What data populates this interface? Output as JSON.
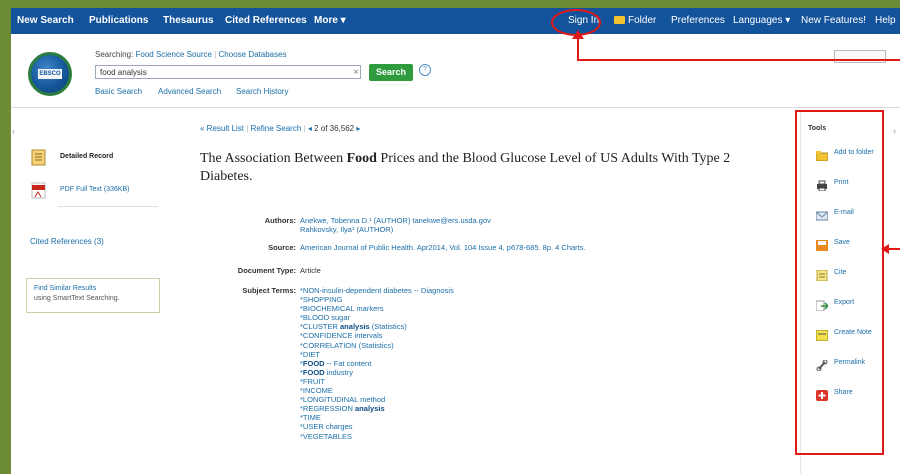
{
  "topnav": {
    "new_search": "New Search",
    "publications": "Publications",
    "thesaurus": "Thesaurus",
    "cited_references": "Cited References",
    "more": "More ▾",
    "sign_in": "Sign In",
    "folder": "Folder",
    "preferences": "Preferences",
    "languages": "Languages ▾",
    "new_features": "New Features!",
    "help": "Help"
  },
  "header": {
    "logo_text": "EBSCO",
    "searching_label": "Searching:",
    "database": "Food Science Source",
    "choose_databases": "Choose Databases",
    "search_value": "food analysis",
    "search_button": "Search",
    "basic_search": "Basic Search",
    "advanced_search": "Advanced Search",
    "search_history": "Search History"
  },
  "left": {
    "detailed_record": "Detailed Record",
    "pdf_full_text": "PDF Full Text (336KB)",
    "cited_references": "Cited References (3)",
    "find_similar": "Find Similar Results",
    "smarttext": "using SmartText Searching."
  },
  "result_nav": {
    "result_list": "« Result List",
    "refine_search": "Refine Search",
    "prev": "◂",
    "position": "2 of 36,562",
    "next": "▸"
  },
  "article": {
    "title_pre": "The Association Between ",
    "title_bold": "Food",
    "title_post": " Prices and the Blood Glucose Level of US Adults With Type 2 Diabetes.",
    "authors_label": "Authors:",
    "author1": "Anekwe, Tobenna D.¹ (AUTHOR) tanekwe@ers.usda.gov",
    "author2": "Rahkovsky, Ilya¹ (AUTHOR)",
    "source_label": "Source:",
    "source": "American Journal of Public Health. Apr2014, Vol. 104 Issue 4, p678-685. 8p. 4 Charts.",
    "doctype_label": "Document Type:",
    "doctype": "Article",
    "subject_label": "Subject Terms:",
    "subjects": [
      {
        "pre": "*NON-insulin-dependent diabetes -- Diagnosis",
        "bold": "",
        "post": ""
      },
      {
        "pre": "*SHOPPING",
        "bold": "",
        "post": ""
      },
      {
        "pre": "*BIOCHEMICAL markers",
        "bold": "",
        "post": ""
      },
      {
        "pre": "*BLOOD sugar",
        "bold": "",
        "post": ""
      },
      {
        "pre": "*CLUSTER ",
        "bold": "analysis",
        "post": " (Statistics)"
      },
      {
        "pre": "*CONFIDENCE intervals",
        "bold": "",
        "post": ""
      },
      {
        "pre": "*CORRELATION (Statistics)",
        "bold": "",
        "post": ""
      },
      {
        "pre": "*DIET",
        "bold": "",
        "post": ""
      },
      {
        "pre": "*",
        "bold": "FOOD",
        "post": " -- Fat content"
      },
      {
        "pre": "*",
        "bold": "FOOD",
        "post": " industry"
      },
      {
        "pre": "*FRUIT",
        "bold": "",
        "post": ""
      },
      {
        "pre": "*INCOME",
        "bold": "",
        "post": ""
      },
      {
        "pre": "*LONGITUDINAL method",
        "bold": "",
        "post": ""
      },
      {
        "pre": "*REGRESSION ",
        "bold": "analysis",
        "post": ""
      },
      {
        "pre": "*TIME",
        "bold": "",
        "post": ""
      },
      {
        "pre": "*USER charges",
        "bold": "",
        "post": ""
      },
      {
        "pre": "*VEGETABLES",
        "bold": "",
        "post": ""
      }
    ]
  },
  "tools": {
    "title": "Tools",
    "items": [
      {
        "label": "Add to folder",
        "icon": "folder-add-icon"
      },
      {
        "label": "Print",
        "icon": "print-icon"
      },
      {
        "label": "E-mail",
        "icon": "email-icon"
      },
      {
        "label": "Save",
        "icon": "save-icon"
      },
      {
        "label": "Cite",
        "icon": "cite-icon"
      },
      {
        "label": "Export",
        "icon": "export-icon"
      },
      {
        "label": "Create Note",
        "icon": "note-icon"
      },
      {
        "label": "Permalink",
        "icon": "link-icon"
      },
      {
        "label": "Share",
        "icon": "share-icon"
      }
    ]
  },
  "colors": {
    "nav_bg": "#13539b",
    "link": "#1a6ea8",
    "search_button": "#2e9b3c",
    "annotation": "#e01818",
    "page_border": "#6d8b35"
  }
}
